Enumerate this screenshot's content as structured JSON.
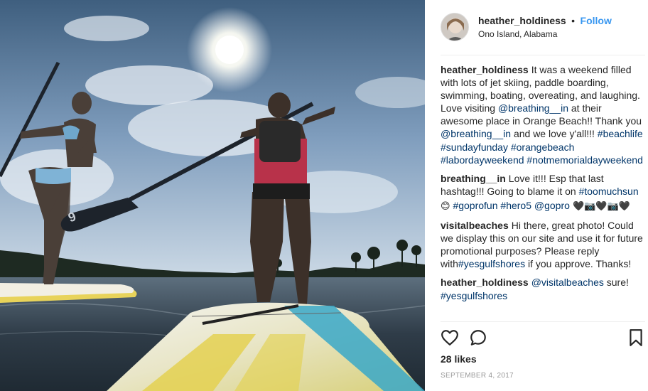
{
  "photo": {
    "icon": "sup-photo",
    "board_number": "9"
  },
  "post": {
    "author": "heather_holdiness",
    "separator": "•",
    "follow_label": "Follow",
    "location": "Ono Island, Alabama"
  },
  "comments": [
    {
      "user": "heather_holdiness",
      "parts": [
        {
          "t": "It was a weekend filled with lots of jet skiing, paddle boarding, swimming, boating, overeating, and laughing. Love visiting "
        },
        {
          "t": "@breathing__in",
          "link": true
        },
        {
          "t": " at their awesome place in Orange Beach!! Thank you "
        },
        {
          "t": "@breathing__in",
          "link": true
        },
        {
          "t": " and we love y'all!!! "
        },
        {
          "t": "#beachlife",
          "link": true
        },
        {
          "t": " "
        },
        {
          "t": "#sundayfunday",
          "link": true
        },
        {
          "t": " "
        },
        {
          "t": "#orangebeach",
          "link": true
        },
        {
          "t": " "
        },
        {
          "t": "#labordayweekend",
          "link": true
        },
        {
          "t": " "
        },
        {
          "t": "#notmemorialdayweekend",
          "link": true
        }
      ]
    },
    {
      "user": "breathing__in",
      "parts": [
        {
          "t": "Love it!!! Esp that last hashtag!!! Going to blame it on "
        },
        {
          "t": "#toomuchsun",
          "link": true
        },
        {
          "t": " 😊",
          "emoji": true
        },
        {
          "t": " "
        },
        {
          "t": "#goprofun",
          "link": true
        },
        {
          "t": " "
        },
        {
          "t": "#hero5",
          "link": true
        },
        {
          "t": " "
        },
        {
          "t": "@gopro",
          "link": true
        },
        {
          "t": " 🖤📷🖤📷🖤",
          "emoji": true
        }
      ]
    },
    {
      "user": "visitalbeaches",
      "parts": [
        {
          "t": "Hi there, great photo! Could we display this on our site and use it for future promotional purposes? Please reply with"
        },
        {
          "t": "#yesgulfshores",
          "link": true
        },
        {
          "t": " if you approve. Thanks!"
        }
      ]
    },
    {
      "user": "heather_holdiness",
      "parts": [
        {
          "t": "@visitalbeaches",
          "link": true
        },
        {
          "t": " sure! "
        },
        {
          "t": "#yesgulfshores",
          "link": true
        }
      ]
    }
  ],
  "actions": {
    "like_icon": "heart-icon",
    "comment_icon": "comment-icon",
    "save_icon": "bookmark-icon"
  },
  "likes_text": "28 likes",
  "date_text": "SEPTEMBER 4, 2017",
  "colors": {
    "link": "#003569",
    "follow": "#3897f0",
    "date": "#999999"
  }
}
